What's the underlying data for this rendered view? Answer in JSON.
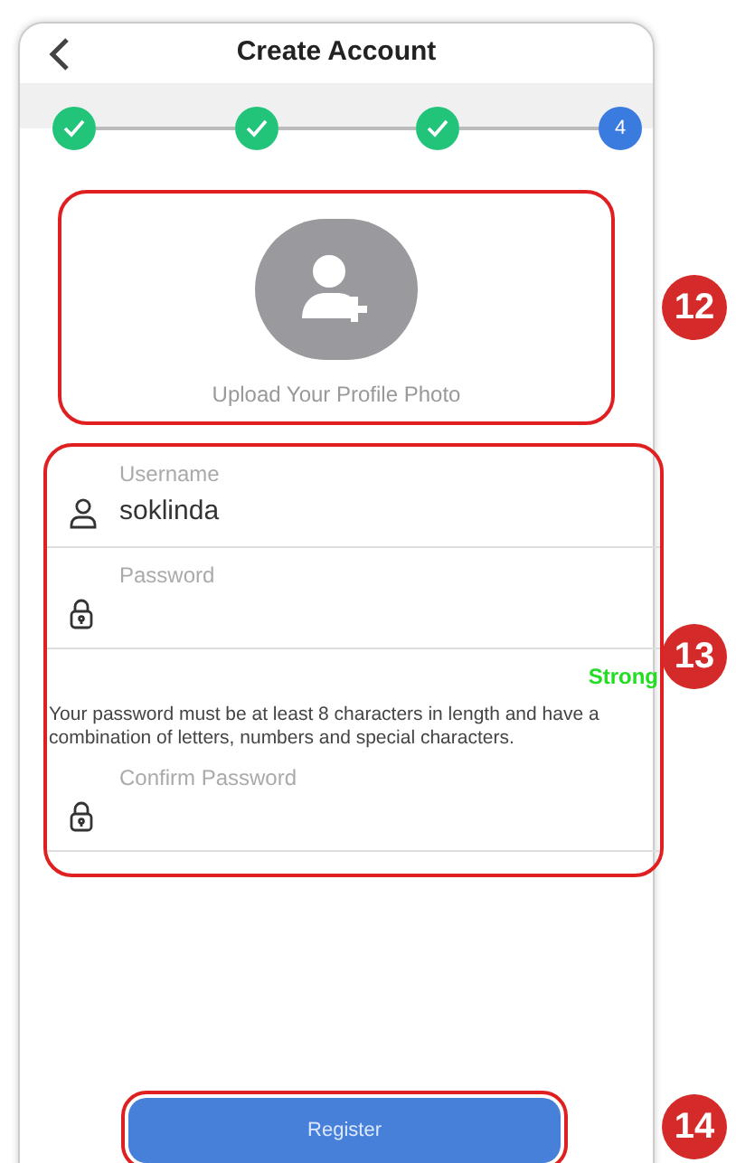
{
  "header": {
    "title": "Create Account"
  },
  "steps": [
    {
      "done": true
    },
    {
      "done": true
    },
    {
      "done": true
    },
    {
      "done": false,
      "label": "4"
    }
  ],
  "photo_upload": {
    "label": "Upload Your Profile Photo"
  },
  "fields": [
    {
      "kind": "user",
      "label": "Username",
      "value": "soklinda"
    },
    {
      "kind": "lock",
      "label": "Password"
    }
  ],
  "strength": {
    "text": "Strong",
    "color": "#22dd22"
  },
  "hint": "Your password must be at least 8 characters in length and have a combination of letters, numbers and special characters.",
  "confirm": {
    "kind": "lock",
    "label": "Confirm Password"
  },
  "register_button": "Register",
  "callouts": [
    "12",
    "13",
    "14"
  ]
}
